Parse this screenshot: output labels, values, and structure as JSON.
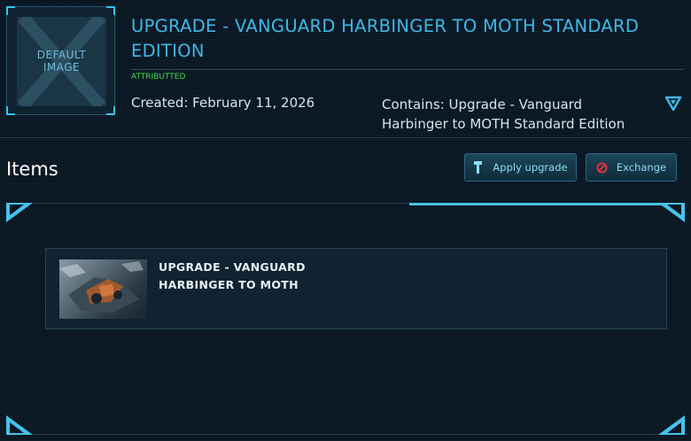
{
  "thumbnail": {
    "line1": "DEFAULT",
    "line2": "IMAGE"
  },
  "pledge": {
    "title": "UPGRADE - VANGUARD HARBINGER TO MOTH STANDARD EDITION",
    "badge": "ATTRIBUTTED",
    "created": "Created: February 11, 2026",
    "contains": "Contains: Upgrade - Vanguard Harbinger to MOTH Standard Edition"
  },
  "items_section": {
    "heading": "Items",
    "actions": [
      {
        "label": "Apply upgrade",
        "icon": "hammer-icon"
      },
      {
        "label": "Exchange",
        "icon": "prohibited-icon"
      }
    ],
    "items": [
      {
        "name": "UPGRADE - VANGUARD HARBINGER TO MOTH"
      }
    ]
  },
  "colors": {
    "accent": "#3fb8e6",
    "badge": "#46d94a",
    "background": "#0a1824",
    "exchange_icon": "#e0313a"
  }
}
